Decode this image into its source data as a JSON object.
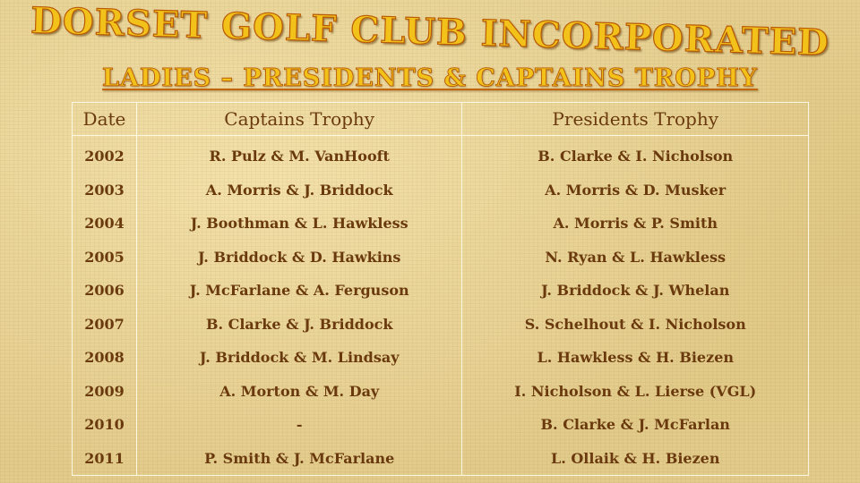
{
  "header": {
    "title": "DORSET GOLF CLUB INCORPORATED",
    "subtitle": "LADIES – PRESIDENTS & CAPTAINS TROPHY"
  },
  "table": {
    "columns": [
      "Date",
      "Captains Trophy",
      "Presidents Trophy"
    ],
    "rows": [
      [
        "2002",
        "R. Pulz & M. VanHooft",
        "B. Clarke & I. Nicholson"
      ],
      [
        "2003",
        "A. Morris & J. Briddock",
        "A. Morris & D. Musker"
      ],
      [
        "2004",
        "J. Boothman & L. Hawkless",
        "A. Morris & P. Smith"
      ],
      [
        "2005",
        "J. Briddock & D. Hawkins",
        "N. Ryan & L. Hawkless"
      ],
      [
        "2006",
        "J. McFarlane & A. Ferguson",
        "J. Briddock & J. Whelan"
      ],
      [
        "2007",
        "B. Clarke & J. Briddock",
        "S. Schelhout & I. Nicholson"
      ],
      [
        "2008",
        "J. Briddock & M. Lindsay",
        "L. Hawkless & H. Biezen"
      ],
      [
        "2009",
        "A. Morton & M. Day",
        "I. Nicholson & L. Lierse (VGL)"
      ],
      [
        "2010",
        "-",
        "B. Clarke & J. McFarlan"
      ],
      [
        "2011",
        "P. Smith & J. McFarlane",
        "L. Ollaik & H. Biezen"
      ]
    ]
  }
}
